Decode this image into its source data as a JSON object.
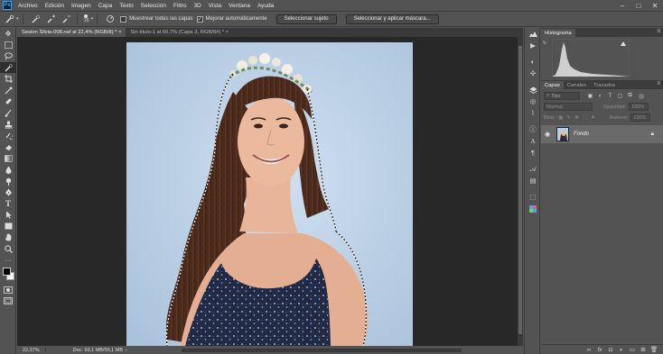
{
  "app": {
    "logo": "Ps",
    "menu": [
      "Archivo",
      "Edición",
      "Imagen",
      "Capa",
      "Texto",
      "Selección",
      "Filtro",
      "3D",
      "Vista",
      "Ventana",
      "Ayuda"
    ],
    "window_controls": [
      "–",
      "□",
      "✕"
    ]
  },
  "options": {
    "brush_size": "16",
    "sample_all_layers_label": "Muestrear todas las capas",
    "auto_enhance_label": "Mejorar automáticamente",
    "select_subject_label": "Seleccionar sujeto",
    "select_and_mask_label": "Seleccionar y aplicar máscara..."
  },
  "tabs": [
    {
      "label": "Sesion Silvia-008.nef al 22,4% (RGB/8) * ×"
    },
    {
      "label": "Sin título-1 al 66,7% (Capa 3, RGB/8#) * ×"
    }
  ],
  "status": {
    "zoom": "22,37%",
    "doc": "Doc: 59,1 MB/59,1 MB"
  },
  "histogram": {
    "title": "Histograma"
  },
  "layers": {
    "tabs": [
      "Capas",
      "Canales",
      "Trazados"
    ],
    "filter_placeholder": "Tipo",
    "blend_mode": "Normal",
    "opacity_label": "Opacidad:",
    "opacity_value": "100%",
    "lock_label": "Bloq.:",
    "fill_label": "Relleno:",
    "fill_value": "100%",
    "items": [
      {
        "name": "Fondo",
        "visible": true,
        "locked": true
      }
    ]
  },
  "icons": {
    "toolbar": [
      "move-icon",
      "marquee-icon",
      "lasso-icon",
      "quick-selection-icon",
      "crop-icon",
      "eyedropper-icon",
      "healing-icon",
      "brush-icon",
      "stamp-icon",
      "history-brush-icon",
      "eraser-icon",
      "gradient-icon",
      "blur-icon",
      "dodge-icon",
      "pen-icon",
      "type-icon",
      "path-selection-icon",
      "shape-icon",
      "hand-icon",
      "zoom-icon",
      "more-tools-icon"
    ],
    "dock": [
      "histogram-icon",
      "play-icon",
      "adjustments-icon",
      "navigator-icon",
      "layers-icon",
      "channels-icon",
      "paths-icon",
      "info-icon",
      "character-icon",
      "paragraph-icon",
      "glyphs-icon",
      "libraries-icon",
      "3d-icon",
      "color-icon"
    ]
  }
}
